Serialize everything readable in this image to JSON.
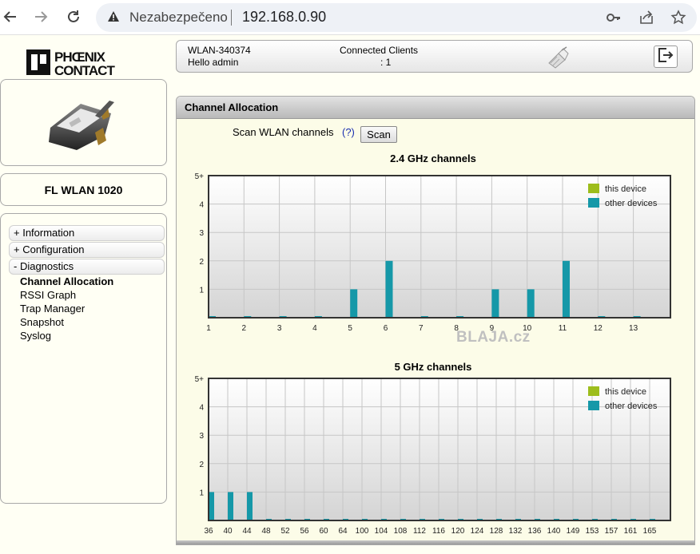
{
  "browser": {
    "security_label": "Nezabezpečeno",
    "url": "192.168.0.90"
  },
  "app": {
    "brand_logo_text": "PHOENIX CONTACT",
    "device_name": "FL WLAN 1020",
    "header": {
      "hostname": "WLAN-340374",
      "greeting": "Hello admin",
      "clients_label": "Connected Clients",
      "clients_value": ": 1"
    },
    "menu": {
      "information": "+ Information",
      "configuration": "+ Configuration",
      "diagnostics": "- Diagnostics",
      "diagnostics_items": [
        "Channel Allocation",
        "RSSI Graph",
        "Trap Manager",
        "Snapshot",
        "Syslog"
      ]
    },
    "content": {
      "title": "Channel Allocation",
      "scan_label": "Scan WLAN channels",
      "help_label": "(?)",
      "scan_button": "Scan"
    },
    "watermark": "BLAJA.cz"
  },
  "colors": {
    "this_device": "#9dbd1c",
    "other_devices": "#1598a8"
  },
  "chart_data": [
    {
      "type": "bar",
      "title": "2.4 GHz channels",
      "categories": [
        "1",
        "2",
        "3",
        "4",
        "5",
        "6",
        "7",
        "8",
        "9",
        "10",
        "11",
        "12",
        "13"
      ],
      "yticks": [
        "1",
        "2",
        "3",
        "4",
        "5+"
      ],
      "ylim": [
        0,
        5
      ],
      "grid": true,
      "legend_position": "top-right",
      "series": [
        {
          "name": "this device",
          "values": [
            0,
            0,
            0,
            0,
            0,
            0,
            0,
            0,
            0,
            0,
            0,
            0,
            0
          ]
        },
        {
          "name": "other devices",
          "values": [
            0,
            0,
            0,
            0,
            1,
            2,
            0,
            0,
            1,
            1,
            2,
            0,
            0
          ]
        }
      ]
    },
    {
      "type": "bar",
      "title": "5 GHz channels",
      "categories": [
        "36",
        "40",
        "44",
        "48",
        "52",
        "56",
        "60",
        "64",
        "100",
        "104",
        "108",
        "112",
        "116",
        "120",
        "124",
        "128",
        "132",
        "136",
        "140",
        "149",
        "153",
        "157",
        "161",
        "165"
      ],
      "yticks": [
        "1",
        "2",
        "3",
        "4",
        "5+"
      ],
      "ylim": [
        0,
        5
      ],
      "grid": true,
      "legend_position": "top-right",
      "series": [
        {
          "name": "this device",
          "values": [
            0,
            0,
            0,
            0,
            0,
            0,
            0,
            0,
            0,
            0,
            0,
            0,
            0,
            0,
            0,
            0,
            0,
            0,
            0,
            0,
            0,
            0,
            0,
            0
          ]
        },
        {
          "name": "other devices",
          "values": [
            1,
            1,
            1,
            0,
            0,
            0,
            0,
            0,
            0,
            0,
            0,
            0,
            0,
            0,
            0,
            0,
            0,
            0,
            0,
            0,
            0,
            0,
            0,
            0
          ]
        }
      ]
    }
  ]
}
